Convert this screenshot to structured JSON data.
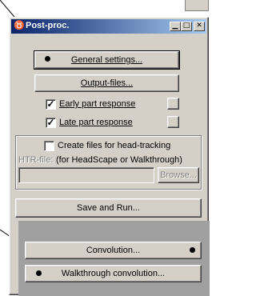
{
  "window": {
    "title": "Post-proc.",
    "controls": [
      "minimize",
      "maximize",
      "close"
    ]
  },
  "buttons": {
    "general_settings": "General settings...",
    "output_files": "Output-files...",
    "save_and_run": "Save and Run...",
    "convolution": "Convolution...",
    "walkthrough_convolution": "Walkthrough convolution...",
    "browse": "Browse..."
  },
  "options": {
    "early_part_response": {
      "label": "Early part response",
      "checked": true
    },
    "late_part_response": {
      "label": "Late part response",
      "checked": true
    },
    "head_tracking": {
      "label": "Create files for head-tracking",
      "checked": false
    }
  },
  "htr": {
    "label": "HTR-file:",
    "hint": "(for HeadScape or Walkthrough)",
    "value": ""
  },
  "colors": {
    "titlebar_start": "#0a246a",
    "titlebar_end": "#a6caf0",
    "face": "#d4d0c8",
    "highlight_panel": "#a0a0a0"
  }
}
